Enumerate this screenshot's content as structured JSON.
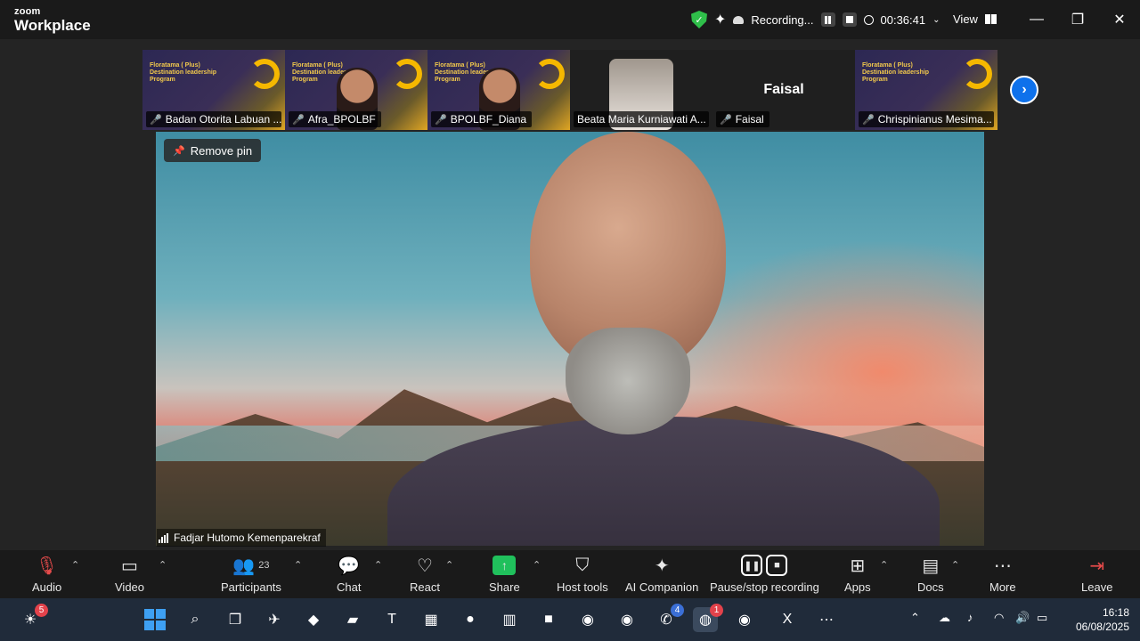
{
  "titlebar": {
    "brand_top": "zoom",
    "brand_bottom": "Workplace",
    "recording_label": "Recording...",
    "timer": "00:36:41",
    "view_label": "View",
    "min": "—",
    "restore": "❐",
    "close": "✕"
  },
  "banner": {
    "text": "Floratama ( Plus) Destination leadership Program"
  },
  "thumbnails": [
    {
      "name": "Badan Otorita Labuan ..."
    },
    {
      "name": "Afra_BPOLBF"
    },
    {
      "name": "BPOLBF_Diana"
    },
    {
      "name": "Beata Maria Kurniawati A..."
    },
    {
      "name": "Faisal",
      "display_name": "Faisal"
    },
    {
      "name": "Chrispinianus Mesima..."
    }
  ],
  "main": {
    "remove_pin": "Remove pin",
    "speaker_name": "Fadjar Hutomo Kemenparekraf"
  },
  "toolbar": {
    "audio": "Audio",
    "video": "Video",
    "participants": "Participants",
    "participants_count": "23",
    "chat": "Chat",
    "react": "React",
    "share": "Share",
    "host_tools": "Host tools",
    "ai_companion": "AI Companion",
    "pause_stop": "Pause/stop recording",
    "apps": "Apps",
    "docs": "Docs",
    "more": "More",
    "leave": "Leave"
  },
  "taskbar": {
    "weather_badge": "5",
    "whatsapp_badge": "4",
    "zoom_badge": "1",
    "time": "16:18",
    "date": "06/08/2025"
  },
  "colors": {
    "accent_blue": "#0e71eb",
    "share_green": "#20c05c",
    "mic_off_red": "#e64b4b",
    "shield_green": "#2fbf4a"
  }
}
